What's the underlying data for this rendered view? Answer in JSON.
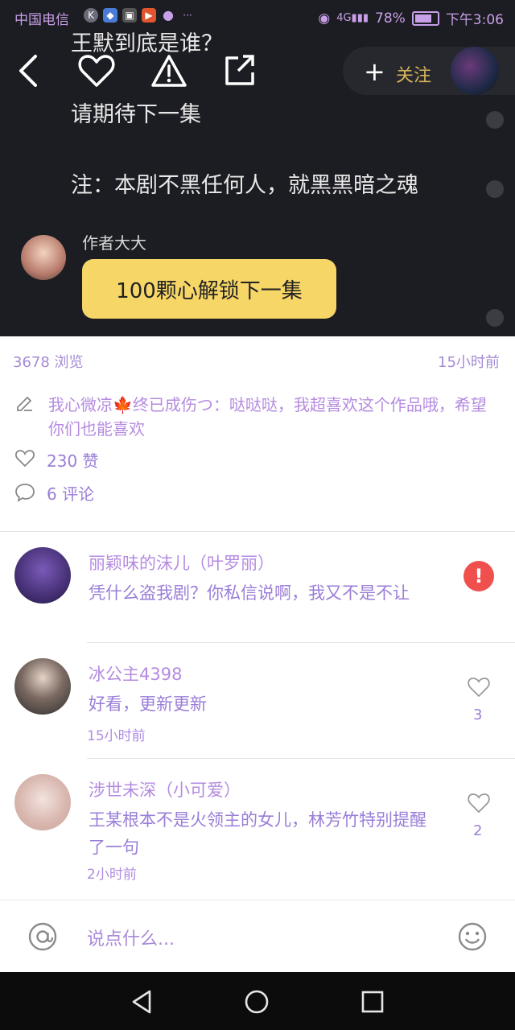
{
  "status_bar": {
    "carrier": "中国电信",
    "battery": "78%",
    "time": "下午3:06"
  },
  "story": {
    "line1": "王默到底是谁？",
    "line2": "请期待下一集",
    "line3": "注：本剧不黑任何人，就黑黑暗之魂"
  },
  "header": {
    "follow_label": "关注",
    "follow_plus": "+"
  },
  "author": {
    "name": "作者大大",
    "unlock_button": "100颗心解锁下一集"
  },
  "info": {
    "views": "3678 浏览",
    "posted": "15小时前",
    "description": "我心微凉🍁终已成伤つ：哒哒哒，我超喜欢这个作品哦，希望你们也能喜欢",
    "likes": "230 赞",
    "comments": "6 评论"
  },
  "comments": [
    {
      "name": "丽颖味的沫儿（叶罗丽）",
      "text": "凭什么盗我剧？你私信说啊，我又不是不让",
      "time": "",
      "likes": "",
      "alert": "!"
    },
    {
      "name": "冰公主4398",
      "text": "好看，更新更新",
      "time": "15小时前",
      "likes": "3"
    },
    {
      "name": "涉世未深（小可爱）",
      "text": "王某根本不是火领主的女儿，林芳竹特别提醒了一句",
      "time": "2小时前",
      "likes": "2"
    }
  ],
  "input": {
    "placeholder": "说点什么..."
  },
  "colors": {
    "dark_bg": "#1c1d22",
    "accent_yellow": "#f7d668",
    "follow_gold": "#d7b35a",
    "text_purple": "#b58be0",
    "alert_red": "#f0504d"
  }
}
